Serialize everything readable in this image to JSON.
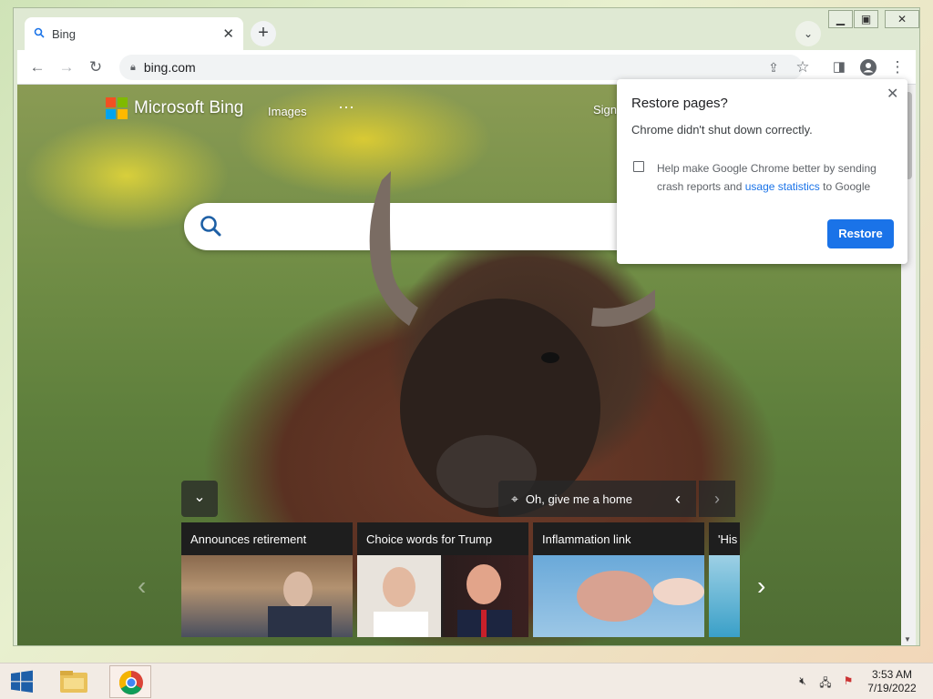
{
  "browser": {
    "tab_title": "Bing",
    "url": "bing.com",
    "new_tab_symbol": "+",
    "window_controls": [
      "minimize-icon",
      "restore-icon",
      "close-icon"
    ]
  },
  "bing": {
    "brand": "Microsoft Bing",
    "nav_images": "Images",
    "nav_more": "···",
    "nav_signin": "Sign",
    "logo_colors": [
      "#f25022",
      "#7fba00",
      "#00a4ef",
      "#ffb900"
    ],
    "image_title": "Oh, give me a home",
    "cards": [
      {
        "caption": "Announces retirement"
      },
      {
        "caption": "Choice words for Trump"
      },
      {
        "caption": "Inflammation link"
      },
      {
        "caption": "'His"
      }
    ]
  },
  "restore_dialog": {
    "title": "Restore pages?",
    "message": "Chrome didn't shut down correctly.",
    "help_text_1": "Help make Google Chrome better by sending crash reports and",
    "help_link": "usage statistics",
    "help_text_2": "to Google",
    "button": "Restore",
    "accent": "#1a73e8"
  },
  "taskbar": {
    "time": "3:53 AM",
    "date": "7/19/2022"
  }
}
